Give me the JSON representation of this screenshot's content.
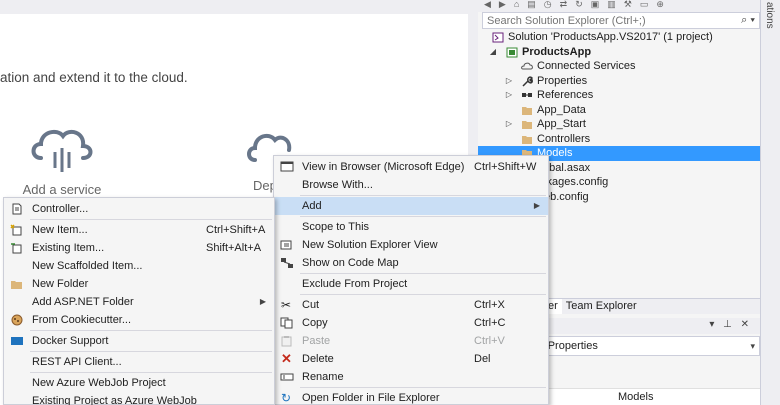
{
  "start_page": {
    "tagline": "ation and extend it to the cloud.",
    "cards": [
      {
        "label": "Add a service",
        "icon": "cloud-service-icon"
      },
      {
        "label": "Deplo",
        "icon": "cloud-deploy-icon"
      }
    ]
  },
  "solution_explorer": {
    "search_placeholder": "Search Solution Explorer (Ctrl+;)",
    "search_icon": "search-icon",
    "tree": [
      {
        "label": "Solution 'ProductsApp.VS2017' (1 project)",
        "icon": "solution-icon",
        "bold": false
      },
      {
        "label": "ProductsApp",
        "icon": "project-icon",
        "bold": true
      },
      {
        "label": "Connected Services",
        "icon": "connected-services-icon",
        "bold": false
      },
      {
        "label": "Properties",
        "icon": "wrench-icon",
        "bold": false
      },
      {
        "label": "References",
        "icon": "references-icon",
        "bold": false
      },
      {
        "label": "App_Data",
        "icon": "folder-icon",
        "bold": false
      },
      {
        "label": "App_Start",
        "icon": "folder-icon",
        "bold": false
      },
      {
        "label": "Controllers",
        "icon": "folder-icon",
        "bold": false
      },
      {
        "label": "Models",
        "icon": "folder-icon",
        "bold": false
      },
      {
        "label": "obal.asax",
        "icon": "",
        "bold": false
      },
      {
        "label": "ckages.config",
        "icon": "",
        "bold": false
      },
      {
        "label": "eb.config",
        "icon": "",
        "bold": false
      }
    ],
    "tabs": [
      "er",
      "Team Explorer"
    ],
    "properties_title": "r Properties",
    "properties_row_value": "Models",
    "side_label": "ations"
  },
  "context_menu": [
    {
      "label": "View in Browser (Microsoft Edge)",
      "shortcut": "Ctrl+Shift+W",
      "icon": "browser-icon"
    },
    {
      "label": "Browse With...",
      "shortcut": "",
      "icon": ""
    },
    {
      "label": "Add",
      "shortcut": "",
      "icon": "",
      "submenu": true,
      "highlight": true
    },
    {
      "label": "Scope to This",
      "shortcut": "",
      "icon": ""
    },
    {
      "label": "New Solution Explorer View",
      "shortcut": "",
      "icon": "new-view-icon"
    },
    {
      "label": "Show on Code Map",
      "shortcut": "",
      "icon": "code-map-icon"
    },
    {
      "label": "Exclude From Project",
      "shortcut": "",
      "icon": ""
    },
    {
      "label": "Cut",
      "shortcut": "Ctrl+X",
      "icon": "cut-icon"
    },
    {
      "label": "Copy",
      "shortcut": "Ctrl+C",
      "icon": "copy-icon"
    },
    {
      "label": "Paste",
      "shortcut": "Ctrl+V",
      "icon": "paste-icon",
      "disabled": true
    },
    {
      "label": "Delete",
      "shortcut": "Del",
      "icon": "delete-icon"
    },
    {
      "label": "Rename",
      "shortcut": "",
      "icon": "rename-icon"
    },
    {
      "label": "Open Folder in File Explorer",
      "shortcut": "",
      "icon": "open-folder-icon"
    }
  ],
  "add_menu": [
    {
      "label": "Controller...",
      "shortcut": "",
      "icon": "controller-icon"
    },
    {
      "label": "New Item...",
      "shortcut": "Ctrl+Shift+A",
      "icon": "new-item-icon"
    },
    {
      "label": "Existing Item...",
      "shortcut": "Shift+Alt+A",
      "icon": "existing-item-icon"
    },
    {
      "label": "New Scaffolded Item...",
      "shortcut": "",
      "icon": ""
    },
    {
      "label": "New Folder",
      "shortcut": "",
      "icon": "new-folder-icon"
    },
    {
      "label": "Add ASP.NET Folder",
      "shortcut": "",
      "icon": "",
      "submenu": true
    },
    {
      "label": "From Cookiecutter...",
      "shortcut": "",
      "icon": "cookiecutter-icon"
    },
    {
      "label": "Docker Support",
      "shortcut": "",
      "icon": "docker-icon"
    },
    {
      "label": "REST API Client...",
      "shortcut": "",
      "icon": ""
    },
    {
      "label": "New Azure WebJob Project",
      "shortcut": "",
      "icon": ""
    },
    {
      "label": "Existing Project as Azure WebJob",
      "shortcut": "",
      "icon": ""
    }
  ]
}
